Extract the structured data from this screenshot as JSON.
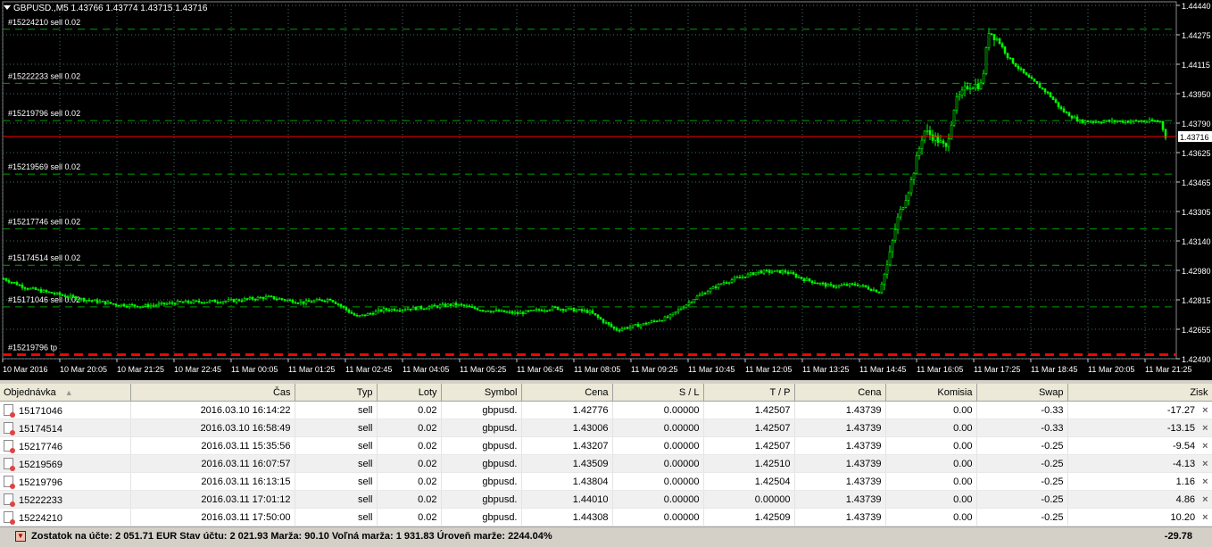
{
  "chart": {
    "title": "GBPUSD.,M5  1.43766 1.43774 1.43715 1.43716",
    "current_price": "1.43716",
    "price_labels": [
      "1.44440",
      "1.44275",
      "1.44115",
      "1.43950",
      "1.43790",
      "1.43625",
      "1.43465",
      "1.43305",
      "1.43140",
      "1.42980",
      "1.42815",
      "1.42655",
      "1.42490"
    ],
    "time_labels": [
      "10 Mar 2016",
      "10 Mar 20:05",
      "10 Mar 21:25",
      "10 Mar 22:45",
      "11 Mar 00:05",
      "11 Mar 01:25",
      "11 Mar 02:45",
      "11 Mar 04:05",
      "11 Mar 05:25",
      "11 Mar 06:45",
      "11 Mar 08:05",
      "11 Mar 09:25",
      "11 Mar 10:45",
      "11 Mar 12:05",
      "11 Mar 13:25",
      "11 Mar 14:45",
      "11 Mar 16:05",
      "11 Mar 17:25",
      "11 Mar 18:45",
      "11 Mar 20:05",
      "11 Mar 21:25"
    ],
    "order_lines": [
      {
        "label": "#15224210 sell 0.02",
        "price": 1.44308
      },
      {
        "label": "#15222233 sell 0.02",
        "price": 1.4401
      },
      {
        "label": "#15219796 sell 0.02",
        "price": 1.43804
      },
      {
        "label": "#15219569 sell 0.02",
        "price": 1.43509
      },
      {
        "label": "#15217746 sell 0.02",
        "price": 1.43207
      },
      {
        "label": "#15174514 sell 0.02",
        "price": 1.43006
      },
      {
        "label": "#15171046 sell 0.02",
        "price": 1.42776
      }
    ],
    "tp_label": "#15219796 tp",
    "tp_price": 1.42507,
    "colors": {
      "background": "#000000",
      "candles": "#00ff00",
      "grid": "#4a6a6a",
      "order_line": "#00a000",
      "price_line": "#ff0000",
      "tp_line": "#ff0000"
    }
  },
  "table": {
    "headers": [
      "Objednávka",
      "Čas",
      "Typ",
      "Loty",
      "Symbol",
      "Cena",
      "S / L",
      "T / P",
      "Cena",
      "Komisia",
      "Swap",
      "Zisk"
    ],
    "rows": [
      [
        "15171046",
        "2016.03.10 16:14:22",
        "sell",
        "0.02",
        "gbpusd.",
        "1.42776",
        "0.00000",
        "1.42507",
        "1.43739",
        "0.00",
        "-0.33",
        "-17.27"
      ],
      [
        "15174514",
        "2016.03.10 16:58:49",
        "sell",
        "0.02",
        "gbpusd.",
        "1.43006",
        "0.00000",
        "1.42507",
        "1.43739",
        "0.00",
        "-0.33",
        "-13.15"
      ],
      [
        "15217746",
        "2016.03.11 15:35:56",
        "sell",
        "0.02",
        "gbpusd.",
        "1.43207",
        "0.00000",
        "1.42507",
        "1.43739",
        "0.00",
        "-0.25",
        "-9.54"
      ],
      [
        "15219569",
        "2016.03.11 16:07:57",
        "sell",
        "0.02",
        "gbpusd.",
        "1.43509",
        "0.00000",
        "1.42510",
        "1.43739",
        "0.00",
        "-0.25",
        "-4.13"
      ],
      [
        "15219796",
        "2016.03.11 16:13:15",
        "sell",
        "0.02",
        "gbpusd.",
        "1.43804",
        "0.00000",
        "1.42504",
        "1.43739",
        "0.00",
        "-0.25",
        "1.16"
      ],
      [
        "15222233",
        "2016.03.11 17:01:12",
        "sell",
        "0.02",
        "gbpusd.",
        "1.44010",
        "0.00000",
        "0.00000",
        "1.43739",
        "0.00",
        "-0.25",
        "4.86"
      ],
      [
        "15224210",
        "2016.03.11 17:50:00",
        "sell",
        "0.02",
        "gbpusd.",
        "1.44308",
        "0.00000",
        "1.42509",
        "1.43739",
        "0.00",
        "-0.25",
        "10.20"
      ]
    ]
  },
  "status": {
    "summary": "Zostatok na účte: 2 051.71 EUR  Stav účtu: 2 021.93  Marža: 90.10  Voľná marža: 1 931.83  Úroveň marže: 2244.04%",
    "total_profit": "-29.78"
  }
}
